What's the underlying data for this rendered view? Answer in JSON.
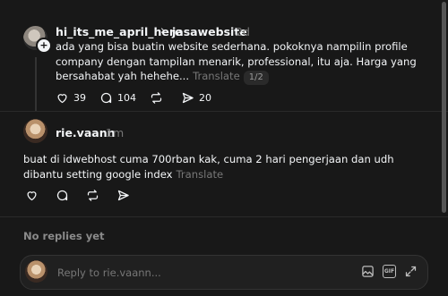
{
  "post": {
    "username": "hi_its_me_april_here",
    "separator": "›",
    "tag": "jasawebsite",
    "time": "2d",
    "text": "ada yang bisa buatin website sederhana. pokoknya nampilin profile company dengan tampilan menarik, professional, itu aja. Harga yang bersahabat yah hehehe...",
    "translate_label": "Translate",
    "page_indicator": "1/2",
    "likes": "39",
    "comments": "104",
    "shares": "20"
  },
  "reply": {
    "username": "rie.vaann",
    "time": "1m",
    "text": "buat di idwebhost cuma 700rban kak, cuma 2 hari pengerjaan dan udh dibantu setting google index",
    "translate_label": "Translate"
  },
  "empty_state": "No replies yet",
  "composer": {
    "placeholder": "Reply to rie.vaann...",
    "icons": [
      "image-icon",
      "gif-icon",
      "expand-icon"
    ]
  },
  "colors": {
    "background": "#181818",
    "text": "#f3f5f7",
    "muted": "#777777"
  }
}
